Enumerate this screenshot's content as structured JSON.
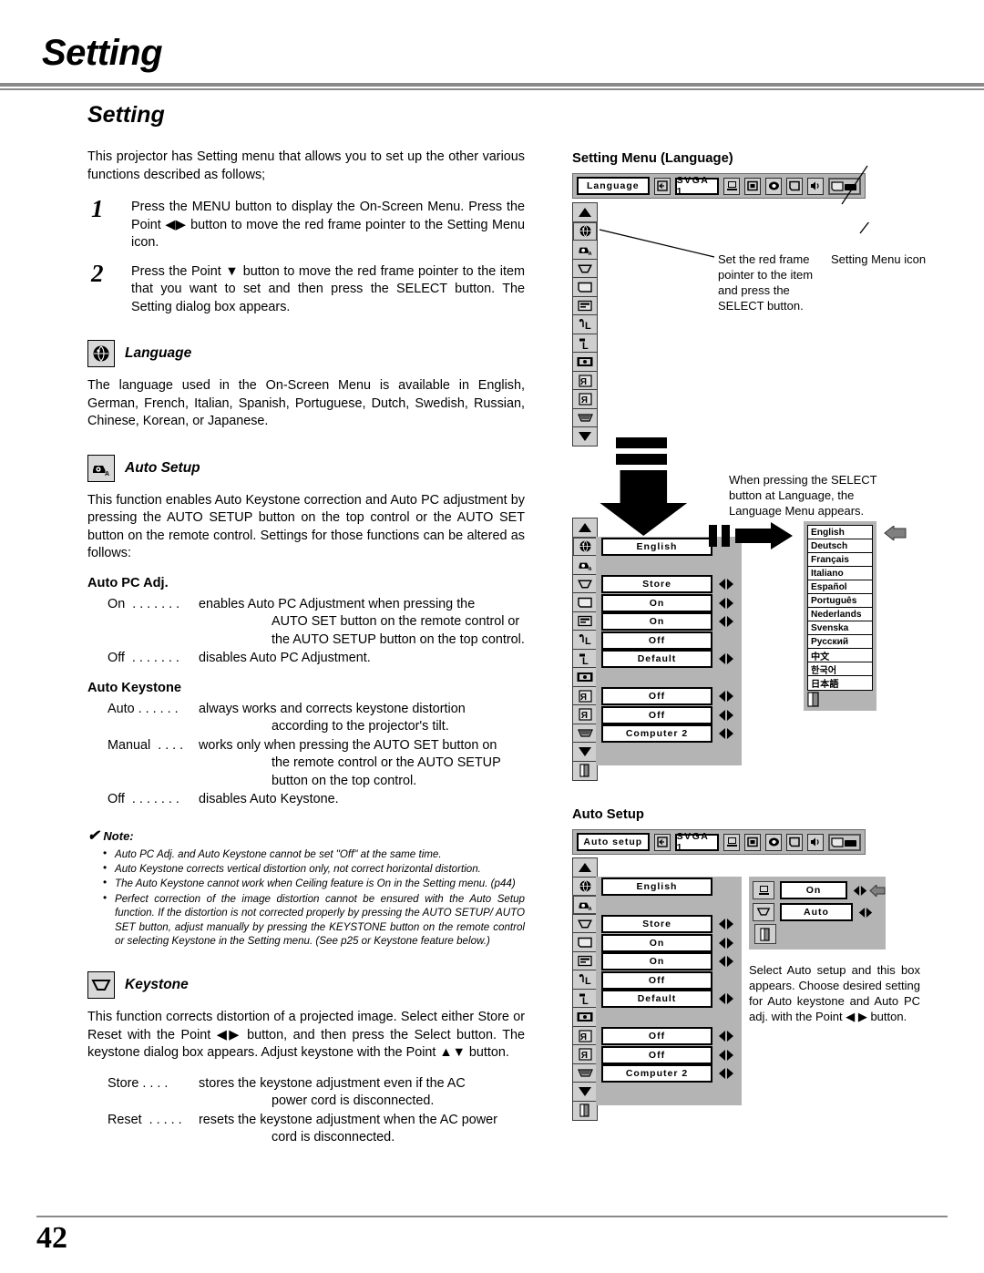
{
  "page": {
    "chapter_title": "Setting",
    "page_number": "42"
  },
  "left": {
    "section_title": "Setting",
    "intro": "This projector has Setting menu that allows you to set up the other various functions described as follows;",
    "steps": [
      {
        "num": "1",
        "text": "Press the MENU button to display the On-Screen Menu. Press the Point ◀▶ button to move the red frame pointer to the Setting Menu icon."
      },
      {
        "num": "2",
        "text": "Press the Point ▼ button to move the red frame pointer to the item that you want to set and then press the SELECT button.  The Setting dialog box appears."
      }
    ],
    "language": {
      "heading": "Language",
      "icon": "globe-icon",
      "body": "The language used in the On-Screen Menu is available in English, German, French, Italian, Spanish, Portuguese, Dutch, Swedish, Russian, Chinese, Korean, or Japanese."
    },
    "auto_setup": {
      "heading": "Auto Setup",
      "icon": "auto-setup-icon",
      "body": "This function enables Auto Keystone correction and Auto PC adjustment by pressing the AUTO SETUP button on the top control or the AUTO SET button on the remote control.  Settings for those functions can be altered as follows:",
      "auto_pc_adj": {
        "heading": "Auto PC Adj.",
        "items": [
          {
            "term": "On  . . . . . . .",
            "desc": "enables Auto PC Adjustment when pressing the",
            "cont": "AUTO SET button on the remote control or the AUTO SETUP button on the top control."
          },
          {
            "term": "Off  . . . . . . .",
            "desc": "disables Auto PC Adjustment.",
            "cont": ""
          }
        ]
      },
      "auto_keystone": {
        "heading": "Auto Keystone",
        "items": [
          {
            "term": "Auto . . . . . . ",
            "desc": "always works and corrects keystone distortion",
            "cont": "according to the projector's tilt."
          },
          {
            "term": "Manual  . . . .",
            "desc": "works only when pressing the AUTO SET button on",
            "cont": "the remote control or the AUTO SETUP button on the top control."
          },
          {
            "term": "Off  . . . . . . .",
            "desc": "disables Auto Keystone.",
            "cont": ""
          }
        ]
      }
    },
    "note": {
      "title": "Note:",
      "check": "✔",
      "items": [
        "Auto PC Adj. and Auto Keystone cannot be set \"Off\" at the same time.",
        "Auto Keystone corrects vertical distortion only, not correct horizontal distortion.",
        "The Auto Keystone cannot work when Ceiling feature is On in the Setting menu. (p44)",
        "Perfect correction of the image distortion cannot be ensured with the Auto Setup function.  If the distortion is not corrected properly by pressing the AUTO SETUP/ AUTO SET button, adjust manually by pressing the KEYSTONE button on the remote control or selecting Keystone in the Setting menu.  (See p25 or Keystone feature below.)"
      ]
    },
    "keystone": {
      "heading": "Keystone",
      "icon": "keystone-icon",
      "body": "This function corrects distortion of a projected image.  Select either Store or Reset with the Point ◀▶ button, and then press the Select button.  The keystone dialog box appears.  Adjust keystone with the Point ▲▼ button.",
      "items": [
        {
          "term": "Store . . . . ",
          "desc": "stores the keystone adjustment even if the AC",
          "cont": "power cord is disconnected."
        },
        {
          "term": "Reset  . . . . .",
          "desc": "resets the keystone adjustment when the AC power",
          "cont": "cord is disconnected."
        }
      ]
    }
  },
  "right": {
    "fig1": {
      "title": "Setting Menu (Language)",
      "bar": {
        "menu_title": "Language",
        "source": "SVGA 1",
        "icons": [
          "input-icon",
          "pc-adjust-icon",
          "image-select-icon",
          "image-adjust-icon",
          "screen-icon",
          "sound-icon",
          "setting-icon"
        ]
      },
      "callout_pointer": "Set the red frame pointer to the item and press the SELECT button.",
      "callout_icon": "Setting Menu icon",
      "callout_select": "When pressing the SELECT button at Language, the Language Menu appears."
    },
    "menu_rows": [
      {
        "icon": "globe-icon",
        "value": "English",
        "arrows": false
      },
      {
        "icon": "auto-setup-icon",
        "value": "",
        "arrows": false
      },
      {
        "icon": "keystone-icon",
        "value": "Store",
        "arrows": true
      },
      {
        "icon": "blue-back-icon",
        "value": "On",
        "arrows": true
      },
      {
        "icon": "display-icon",
        "value": "On",
        "arrows": true
      },
      {
        "icon": "logo-icon",
        "value": "Off",
        "arrows": false
      },
      {
        "icon": "ceiling-icon",
        "value": "Default",
        "arrows": true
      },
      {
        "icon": "security-icon",
        "value": "",
        "arrows": false
      },
      {
        "icon": "rear-icon",
        "value": "Off",
        "arrows": true
      },
      {
        "icon": "mirror-icon",
        "value": "Off",
        "arrows": true
      },
      {
        "icon": "lamp-icon",
        "value": "Computer 2",
        "arrows": true
      }
    ],
    "languages": [
      "English",
      "Deutsch",
      "Français",
      "Italiano",
      "Español",
      "Português",
      "Nederlands",
      "Svenska",
      "Русский",
      "中文",
      "한국어",
      "日本語"
    ],
    "fig2": {
      "title": "Auto Setup",
      "bar": {
        "menu_title": "Auto setup",
        "source": "SVGA 1"
      },
      "dialog_rows": [
        {
          "icon": "pc-adjust-icon",
          "value": "On",
          "arrows": true
        },
        {
          "icon": "keystone-icon",
          "value": "Auto",
          "arrows": true
        }
      ],
      "callout": "Select Auto setup and this box appears.  Choose desired setting for Auto keystone and Auto PC adj. with the Point ◀ ▶ button."
    },
    "menu_rows2": [
      {
        "icon": "globe-icon",
        "value": "English",
        "arrows": false
      },
      {
        "icon": "auto-setup-icon",
        "value": "",
        "arrows": false
      },
      {
        "icon": "keystone-icon",
        "value": "Store",
        "arrows": true
      },
      {
        "icon": "blue-back-icon",
        "value": "On",
        "arrows": true
      },
      {
        "icon": "display-icon",
        "value": "On",
        "arrows": true
      },
      {
        "icon": "logo-icon",
        "value": "Off",
        "arrows": false
      },
      {
        "icon": "ceiling-icon",
        "value": "Default",
        "arrows": true
      },
      {
        "icon": "security-icon",
        "value": "",
        "arrows": false
      },
      {
        "icon": "rear-icon",
        "value": "Off",
        "arrows": true
      },
      {
        "icon": "mirror-icon",
        "value": "Off",
        "arrows": true
      },
      {
        "icon": "lamp-icon",
        "value": "Computer 2",
        "arrows": true
      }
    ]
  }
}
